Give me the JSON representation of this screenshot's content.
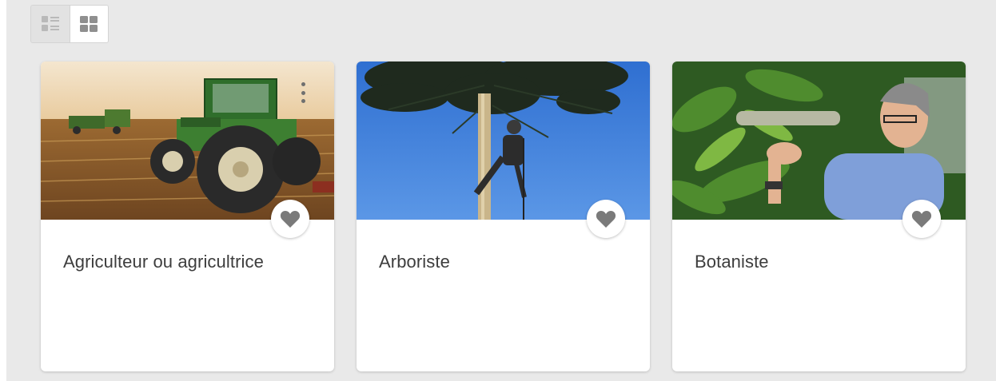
{
  "view_toggle": {
    "list_icon": "list-view-icon",
    "grid_icon": "grid-view-icon",
    "active": "grid"
  },
  "cards": [
    {
      "title": "Agriculteur ou agricultrice",
      "image": "tractor-field-photo",
      "favorite_icon": "heart-icon",
      "menu_icon": "more-vertical-icon"
    },
    {
      "title": "Arboriste",
      "image": "arborist-climbing-tree-photo",
      "favorite_icon": "heart-icon"
    },
    {
      "title": "Botaniste",
      "image": "botanist-with-orchids-photo",
      "favorite_icon": "heart-icon"
    }
  ],
  "colors": {
    "background": "#e9e9e9",
    "card": "#ffffff",
    "title_text": "#3d3d3d",
    "heart": "#7a7a7a"
  }
}
